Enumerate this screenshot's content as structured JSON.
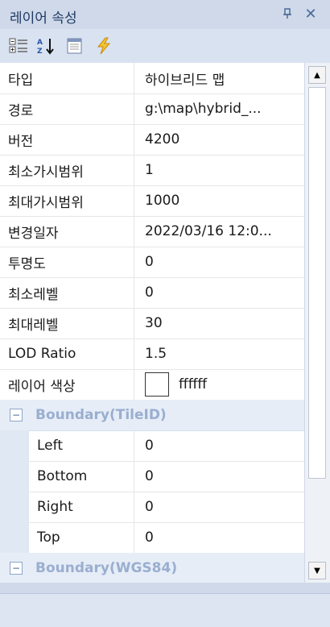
{
  "panel": {
    "title": "레이어 속성",
    "pin_glyph": "⊓",
    "close_glyph": "✕"
  },
  "toolbar": {
    "icons": [
      "categorized-icon",
      "alphabetical-sort-icon",
      "property-pages-icon",
      "events-icon"
    ]
  },
  "properties": [
    {
      "name": "타입",
      "value": "하이브리드 맵"
    },
    {
      "name": "경로",
      "value": "g:\\map\\hybrid_..."
    },
    {
      "name": "버전",
      "value": "4200"
    },
    {
      "name": "최소가시범위",
      "value": "1"
    },
    {
      "name": "최대가시범위",
      "value": "1000"
    },
    {
      "name": "변경일자",
      "value": "2022/03/16 12:0..."
    },
    {
      "name": "투명도",
      "value": "0"
    },
    {
      "name": "최소레벨",
      "value": "0"
    },
    {
      "name": "최대레벨",
      "value": "30"
    },
    {
      "name": "LOD Ratio",
      "value": "1.5"
    },
    {
      "name": "레이어 색상",
      "value": "ffffff",
      "swatch_color": "#ffffff"
    }
  ],
  "categories": [
    {
      "label": "Boundary(TileID)",
      "expander": "⊟",
      "items": [
        {
          "name": "Left",
          "value": "0"
        },
        {
          "name": "Bottom",
          "value": "0"
        },
        {
          "name": "Right",
          "value": "0"
        },
        {
          "name": "Top",
          "value": "0"
        }
      ]
    },
    {
      "label": "Boundary(WGS84)",
      "expander": "⊟",
      "items": []
    }
  ],
  "scrollbar": {
    "up": "▲",
    "down": "▼"
  }
}
